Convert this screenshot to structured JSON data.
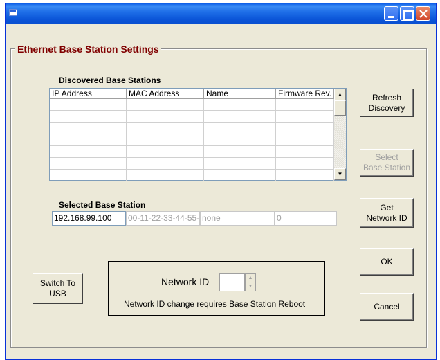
{
  "window": {
    "title": ""
  },
  "group_title": "Ethernet Base Station Settings",
  "discovered": {
    "label": "Discovered Base Stations",
    "columns": [
      "IP Address",
      "MAC Address",
      "Name",
      "Firmware Rev."
    ],
    "rows": [
      [
        "",
        "",
        "",
        ""
      ],
      [
        "",
        "",
        "",
        ""
      ],
      [
        "",
        "",
        "",
        ""
      ],
      [
        "",
        "",
        "",
        ""
      ],
      [
        "",
        "",
        "",
        ""
      ],
      [
        "",
        "",
        "",
        ""
      ],
      [
        "",
        "",
        "",
        ""
      ]
    ]
  },
  "selected": {
    "label": "Selected Base Station",
    "ip": "192.168.99.100",
    "mac": "00-11-22-33-44-55-",
    "name": "none",
    "firmware": "0"
  },
  "buttons": {
    "refresh": [
      "Refresh",
      "Discovery"
    ],
    "select": [
      "Select",
      "Base Station"
    ],
    "get_network_id": [
      "Get",
      "Network ID"
    ],
    "ok": "OK",
    "cancel": "Cancel",
    "switch_usb": [
      "Switch To",
      "USB"
    ]
  },
  "network": {
    "label": "Network ID",
    "value": "",
    "note": "Network ID change requires Base Station Reboot"
  },
  "colors": {
    "title_accent": "#800000",
    "titlebar": "#0a55d8"
  }
}
